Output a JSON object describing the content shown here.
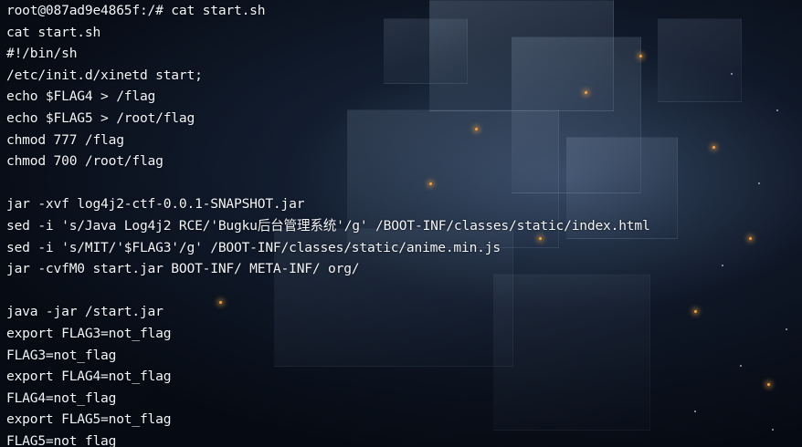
{
  "terminal": {
    "lines": [
      "root@087ad9e4865f:/# cat start.sh",
      "cat start.sh",
      "#!/bin/sh",
      "/etc/init.d/xinetd start;",
      "echo $FLAG4 > /flag",
      "echo $FLAG5 > /root/flag",
      "chmod 777 /flag",
      "chmod 700 /root/flag",
      "",
      "jar -xvf log4j2-ctf-0.0.1-SNAPSHOT.jar",
      "sed -i 's/Java Log4j2 RCE/'Bugku后台管理系统'/g' /BOOT-INF/classes/static/index.html",
      "sed -i 's/MIT/'$FLAG3'/g' /BOOT-INF/classes/static/anime.min.js",
      "jar -cvfM0 start.jar BOOT-INF/ META-INF/ org/",
      "",
      "java -jar /start.jar",
      "export FLAG3=not_flag",
      "FLAG3=not_flag",
      "export FLAG4=not_flag",
      "FLAG4=not_flag",
      "export FLAG5=not_flag",
      "FLAG5=not_flag"
    ]
  },
  "colors": {
    "text": "#f2f5fa",
    "background": "#0b1018",
    "accent_spark": "#f0a34a"
  }
}
